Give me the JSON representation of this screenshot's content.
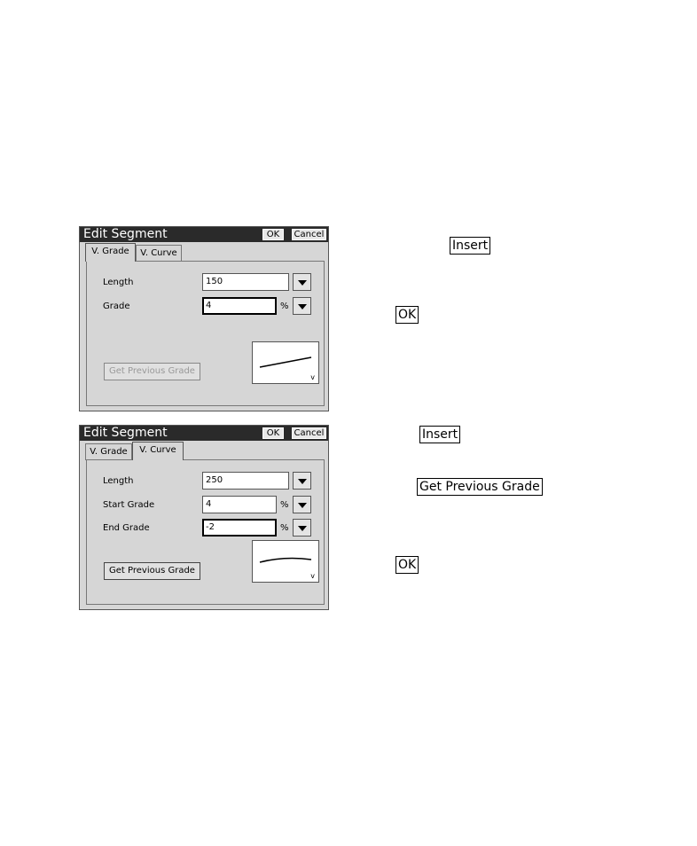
{
  "dialog1": {
    "title": "Edit Segment",
    "ok_label": "OK",
    "cancel_label": "Cancel",
    "tab_grade_label": "V. Grade",
    "tab_curve_label": "V. Curve",
    "active_tab": "V. Grade",
    "length_label": "Length",
    "length_value": "150",
    "grade_label": "Grade",
    "grade_value": "4",
    "grade_unit": "%",
    "get_previous_grade_label": "Get Previous Grade",
    "get_previous_grade_enabled": false,
    "preview_label": "v"
  },
  "dialog2": {
    "title": "Edit Segment",
    "ok_label": "OK",
    "cancel_label": "Cancel",
    "tab_grade_label": "V. Grade",
    "tab_curve_label": "V. Curve",
    "active_tab": "V. Curve",
    "length_label": "Length",
    "length_value": "250",
    "start_grade_label": "Start Grade",
    "start_grade_value": "4",
    "start_grade_unit": "%",
    "end_grade_label": "End Grade",
    "end_grade_value": "-2",
    "end_grade_unit": "%",
    "get_previous_grade_label": "Get Previous Grade",
    "get_previous_grade_enabled": true,
    "preview_label": "v"
  },
  "annotations": {
    "insert_1": "Insert",
    "ok_1": "OK",
    "insert_2": "Insert",
    "get_previous_grade": "Get Previous Grade",
    "ok_2": "OK"
  }
}
